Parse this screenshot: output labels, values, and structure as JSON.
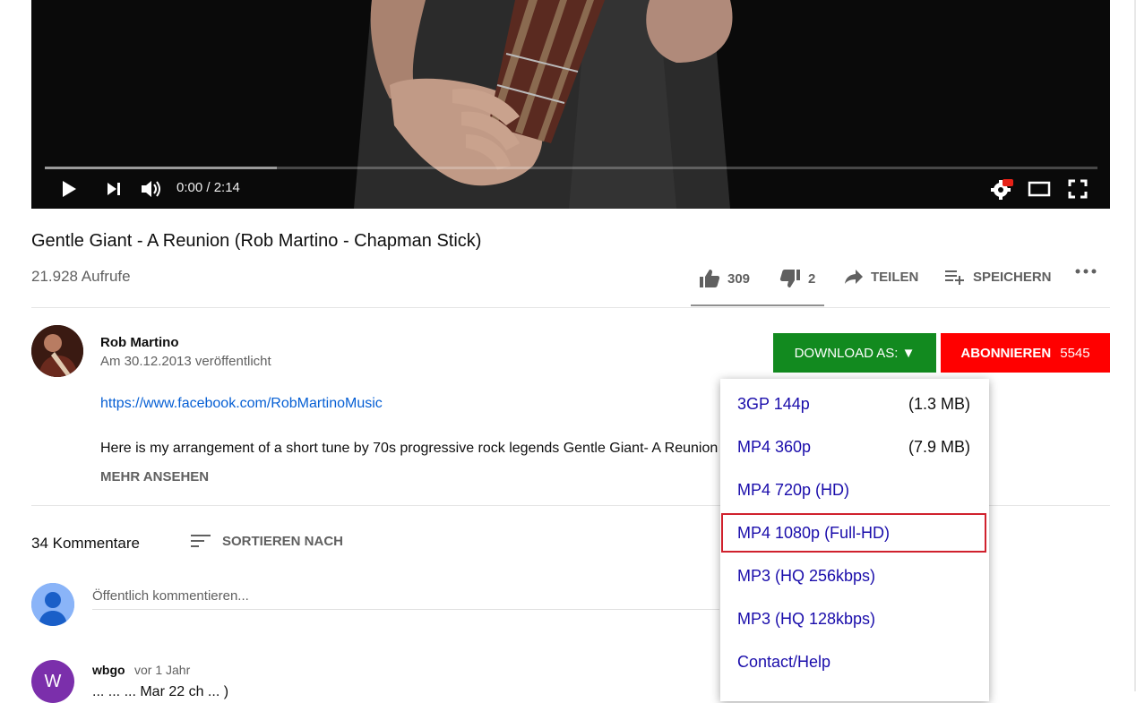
{
  "player": {
    "time_display": "0:00 / 2:14",
    "progress_fraction": 0.0,
    "buffered_fraction": 0.22,
    "settings_badge": "HD"
  },
  "video": {
    "title": "Gentle Giant - A Reunion (Rob Martino - Chapman Stick)",
    "views": "21.928 Aufrufe",
    "likes": "309",
    "dislikes": "2",
    "share_label": "TEILEN",
    "save_label": "SPEICHERN"
  },
  "channel": {
    "name": "Rob Martino",
    "published": "Am 30.12.2013 veröffentlicht",
    "description_link": "https://www.facebook.com/RobMartinoMusic",
    "description_text": "Here is my arrangement of a short tune by 70s progressive rock legends Gentle Giant- A Reunion",
    "more_label": "MEHR ANSEHEN",
    "download_label": "DOWNLOAD AS: ▼",
    "subscribe_label": "ABONNIEREN",
    "subscriber_count": "5545"
  },
  "download_menu": {
    "items": [
      {
        "label": "3GP 144p",
        "size": "(1.3 MB)"
      },
      {
        "label": "MP4 360p",
        "size": "(7.9 MB)"
      },
      {
        "label": "MP4 720p (HD)",
        "size": ""
      },
      {
        "label": "MP4 1080p (Full-HD)",
        "size": "",
        "selected": true
      },
      {
        "label": "MP3 (HQ 256kbps)",
        "size": ""
      },
      {
        "label": "MP3 (HQ 128kbps)",
        "size": ""
      },
      {
        "label": "Contact/Help",
        "size": ""
      }
    ]
  },
  "comments": {
    "count_label": "34 Kommentare",
    "sort_label": "SORTIEREN NACH",
    "input_placeholder": "Öffentlich kommentieren...",
    "first_comment": {
      "avatar_letter": "W",
      "author": "wbgo",
      "time": "vor 1 Jahr",
      "text": "... ... ... Mar 22 ch ... )"
    }
  },
  "colors": {
    "download_green": "#128a1f",
    "subscribe_red": "#ff0000",
    "link_blue": "#065fd4",
    "menu_text": "#1a0dab",
    "selected_outline": "#d0212d"
  }
}
